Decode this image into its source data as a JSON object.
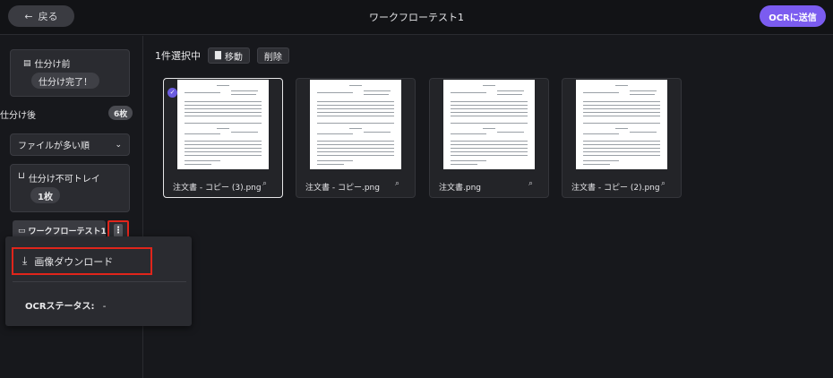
{
  "header": {
    "back_label": "戻る",
    "title": "ワークフローテスト1",
    "ocr_button": "OCRに送信"
  },
  "sidebar": {
    "before_label": "仕分け前",
    "done_badge": "仕分け完了！",
    "after_label": "仕分け後",
    "after_count": "6枚",
    "sort_value": "ファイルが多い順",
    "tray_label": "仕分け不可トレイ",
    "tray_count": "1枚",
    "workflow_label": "ワークフローテスト1",
    "kebab_glyph": "⋮"
  },
  "popup": {
    "download_label": "画像ダウンロード",
    "ocr_status_label": "OCRステータス:",
    "ocr_status_value": "-"
  },
  "toolbar": {
    "selection_text": "1件選択中",
    "move_label": "移動",
    "delete_label": "削除"
  },
  "files": [
    {
      "name": "注文書 - コピー (3).png",
      "selected": true
    },
    {
      "name": "注文書 - コピー.png",
      "selected": false
    },
    {
      "name": "注文書.png",
      "selected": false
    },
    {
      "name": "注文書 - コピー (2).png",
      "selected": false
    }
  ],
  "colors": {
    "accent": "#7b5cf0",
    "highlight": "#e0251b",
    "background": "#17181c"
  }
}
